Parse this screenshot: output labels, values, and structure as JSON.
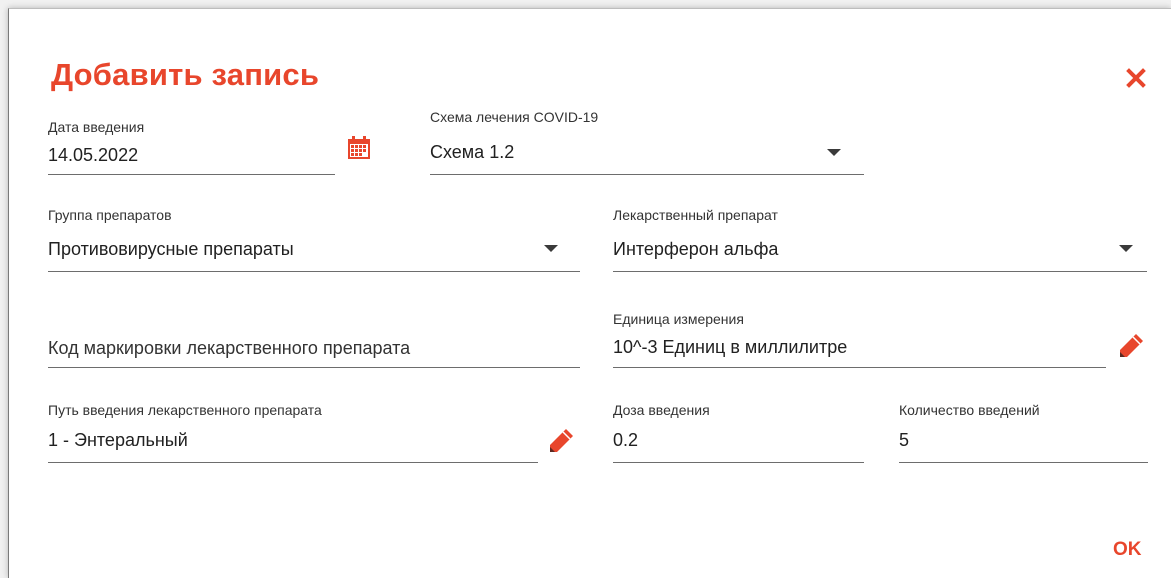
{
  "dialog": {
    "title": "Добавить запись",
    "ok_label": "OK",
    "accent_color": "#e8462c"
  },
  "fields": {
    "date": {
      "label": "Дата введения",
      "value": "14.05.2022"
    },
    "scheme": {
      "label": "Схема лечения COVID-19",
      "value": "Схема 1.2"
    },
    "drug_group": {
      "label": "Группа препаратов",
      "value": "Противовирусные препараты"
    },
    "drug": {
      "label": "Лекарственный препарат",
      "value": "Интерферон альфа"
    },
    "marking_code": {
      "placeholder": "Код маркировки лекарственного препарата"
    },
    "unit": {
      "label": "Единица измерения",
      "value": "10^-3 Единиц в миллилитре"
    },
    "route": {
      "label": "Путь введения лекарственного препарата",
      "value": "1 - Энтеральный"
    },
    "dose": {
      "label": "Доза введения",
      "value": "0.2"
    },
    "count": {
      "label": "Количество введений",
      "value": "5"
    }
  },
  "icons": {
    "close": "close-icon",
    "calendar": "calendar-icon",
    "edit": "pencil-icon",
    "dropdown": "chevron-down-icon"
  }
}
